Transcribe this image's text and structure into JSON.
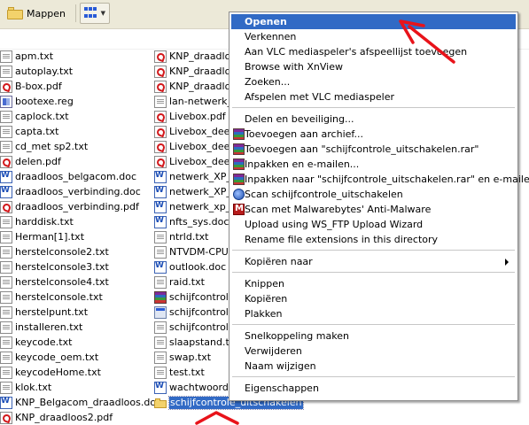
{
  "toolbar": {
    "folders_label": "Mappen",
    "views_icon": "views-grid-icon"
  },
  "files_col1": [
    {
      "name": "apm.txt",
      "type": "txt"
    },
    {
      "name": "autoplay.txt",
      "type": "txt"
    },
    {
      "name": "B-box.pdf",
      "type": "pdf"
    },
    {
      "name": "bootexe.reg",
      "type": "reg"
    },
    {
      "name": "caplock.txt",
      "type": "txt"
    },
    {
      "name": "capta.txt",
      "type": "txt"
    },
    {
      "name": "cd_met sp2.txt",
      "type": "txt"
    },
    {
      "name": "delen.pdf",
      "type": "pdf"
    },
    {
      "name": "draadloos_belgacom.doc",
      "type": "doc"
    },
    {
      "name": "draadloos_verbinding.doc",
      "type": "doc"
    },
    {
      "name": "draadloos_verbinding.pdf",
      "type": "pdf"
    },
    {
      "name": "harddisk.txt",
      "type": "txt"
    },
    {
      "name": "Herman[1].txt",
      "type": "txt"
    },
    {
      "name": "herstelconsole2.txt",
      "type": "txt"
    },
    {
      "name": "herstelconsole3.txt",
      "type": "txt"
    },
    {
      "name": "herstelconsole4.txt",
      "type": "txt"
    },
    {
      "name": "herstelconsole.txt",
      "type": "txt"
    },
    {
      "name": "herstelpunt.txt",
      "type": "txt"
    },
    {
      "name": "installeren.txt",
      "type": "txt"
    },
    {
      "name": "keycode.txt",
      "type": "txt"
    },
    {
      "name": "keycode_oem.txt",
      "type": "txt"
    },
    {
      "name": "keycodeHome.txt",
      "type": "txt"
    },
    {
      "name": "klok.txt",
      "type": "txt"
    },
    {
      "name": "KNP_Belgacom_draadloos.doc",
      "type": "doc"
    },
    {
      "name": "KNP_draadloos2.pdf",
      "type": "pdf"
    }
  ],
  "files_col2": [
    {
      "name": "KNP_draadloos",
      "type": "pdf"
    },
    {
      "name": "KNP_draadloos",
      "type": "pdf"
    },
    {
      "name": "KNP_draadloos",
      "type": "pdf"
    },
    {
      "name": "lan-netwerk_",
      "type": "txt"
    },
    {
      "name": "Livebox.pdf",
      "type": "pdf"
    },
    {
      "name": "Livebox_deel",
      "type": "pdf"
    },
    {
      "name": "Livebox_deel",
      "type": "pdf"
    },
    {
      "name": "Livebox_deel",
      "type": "pdf"
    },
    {
      "name": "netwerk_XP_",
      "type": "doc"
    },
    {
      "name": "netwerk_XP_",
      "type": "doc"
    },
    {
      "name": "netwerk_xp_",
      "type": "doc"
    },
    {
      "name": "nfts_sys.doc",
      "type": "doc"
    },
    {
      "name": "ntrld.txt",
      "type": "txt"
    },
    {
      "name": "NTVDM-CPU.t",
      "type": "txt"
    },
    {
      "name": "outlook.doc",
      "type": "doc"
    },
    {
      "name": "raid.txt",
      "type": "txt"
    },
    {
      "name": "schijfcontrole",
      "type": "rar"
    },
    {
      "name": "schijfcontrole",
      "type": "exe"
    },
    {
      "name": "schijfcontrole",
      "type": "txt"
    },
    {
      "name": "slaapstand.tx",
      "type": "txt"
    },
    {
      "name": "swap.txt",
      "type": "txt"
    },
    {
      "name": "test.txt",
      "type": "txt"
    },
    {
      "name": "wachtwoord.",
      "type": "doc"
    },
    {
      "name": "schijfcontrole_uitschakelen",
      "type": "folder",
      "selected": true
    }
  ],
  "context_menu": [
    {
      "label": "Openen",
      "highlight": true
    },
    {
      "label": "Verkennen"
    },
    {
      "label": "Aan VLC mediaspeler's afspeellijst toevoegen"
    },
    {
      "label": "Browse with XnView"
    },
    {
      "label": "Zoeken..."
    },
    {
      "label": "Afspelen met VLC mediaspeler"
    },
    {
      "sep": true
    },
    {
      "label": "Delen en beveiliging..."
    },
    {
      "label": "Toevoegen aan archief...",
      "icon": "rar"
    },
    {
      "label": "Toevoegen aan \"schijfcontrole_uitschakelen.rar\"",
      "icon": "rar"
    },
    {
      "label": "Inpakken en e-mailen...",
      "icon": "rar"
    },
    {
      "label": "Inpakken naar \"schijfcontrole_uitschakelen.rar\" en e-mailen",
      "icon": "rar"
    },
    {
      "label": "Scan schijfcontrole_uitschakelen",
      "icon": "scan"
    },
    {
      "label": "Scan met Malwarebytes' Anti-Malware",
      "icon": "mwb"
    },
    {
      "label": "Upload using WS_FTP Upload Wizard"
    },
    {
      "label": "Rename file extensions in this directory"
    },
    {
      "sep": true
    },
    {
      "label": "Kopiëren naar",
      "submenu": true
    },
    {
      "sep": true
    },
    {
      "label": "Knippen"
    },
    {
      "label": "Kopiëren"
    },
    {
      "label": "Plakken"
    },
    {
      "sep": true
    },
    {
      "label": "Snelkoppeling maken"
    },
    {
      "label": "Verwijderen"
    },
    {
      "label": "Naam wijzigen"
    },
    {
      "sep": true
    },
    {
      "label": "Eigenschappen"
    }
  ],
  "colors": {
    "selection": "#316ac5",
    "annotation": "#e8131a"
  }
}
